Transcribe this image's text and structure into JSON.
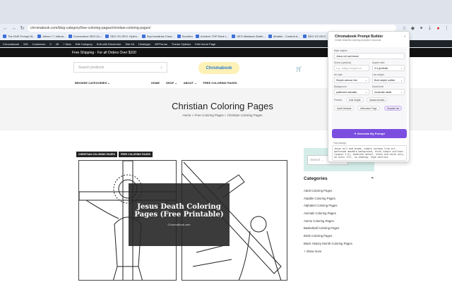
{
  "browser": {
    "url": "chromabook.com/blog-category/free-coloring-pages/christian-coloring-pages/",
    "bookmarks": [
      "The DNS Prompt W...",
      "Meme □□ Ultima...",
      "Ecommerce SEO Gu...",
      "SEO VS GEO: Optim...",
      "Buy backlinks Chea...",
      "Socialbu",
      "Achieve TOP Rank L...",
      "SEO Mistakes Starte...",
      "Airtable - Content A...",
      "SEO VS GEO:",
      "chromabook.com"
    ],
    "wp_admin": [
      "Chromabook",
      "105",
      "Customize",
      "0",
      "26",
      "+ New",
      "Edit Category",
      "Edit with Elementor",
      "Site Kit",
      "Hostinger",
      "WPForms",
      "Theme Options",
      "Edit Home Page"
    ]
  },
  "site": {
    "promo": "Free Shipping - For all Orders Over $100",
    "search_placeholder": "Search products",
    "logo": "Chromabook",
    "nav": {
      "browse": "BROWSE CATEGORIES",
      "links": [
        "HOME",
        "SHOP",
        "ABOUT",
        "FREE COLORING PAGES"
      ]
    },
    "hero": {
      "title": "Christian Coloring Pages",
      "crumbs": "Home » Free Coloring Pages » Christian Coloring Pages"
    },
    "tags": [
      "CHRISTIAN COLORING PAGES",
      "FREE COLORING PAGES"
    ],
    "featured": {
      "title": "Jesus Death Coloring Pages (Free Printable)",
      "watermark": "ChromaBook.com"
    },
    "sidebar": {
      "search_placeholder": "Search ...",
      "categories_title": "Categories",
      "categories": [
        "Adult Coloring Pages",
        "Aladdin Coloring Pages",
        "Alphabet Coloring Pages",
        "Animals Coloring Pages",
        "Anime Coloring Pages",
        "Basketball Coloring Pages",
        "Birds Coloring Pages",
        "Black History Month Coloring Pages"
      ],
      "show_more": "+ Show more"
    }
  },
  "extension": {
    "title": "Chromabook Prompt Builder",
    "subtitle": "Create beautiful coloring prompts in seconds",
    "main_subject_label": "Main subject",
    "main_subject_value": "Jesus roll and bread",
    "scene_label": "Scene (optional)",
    "scene_placeholder": "e.g., riding a bicycle on",
    "aspect_label": "Aspect ratio",
    "aspect_value": "3:4 (portrait)",
    "style_label": "Art style",
    "style_value": "Simple cartoon line",
    "line_label": "Line weight",
    "line_value": "Bold simple outline",
    "bg_label": "Background",
    "bg_value": "patterned mandala",
    "detail_label": "Detail level",
    "detail_value": "moderate detail",
    "presets_label": "Presets",
    "presets": [
      "Kids Simple",
      "Kawaii Animals",
      "Adult Mandala",
      "Affirmation Page",
      "Surprise me"
    ],
    "generate_label": "Generate My Prompt",
    "output_label": "Your prompt",
    "output_text": "Jesus roll and bread, simple cartoon line art, patterned mandala background, thick simple outlines (aspect 3:4), moderate detail, black and white only, no color fill, no shading, high contrast"
  }
}
